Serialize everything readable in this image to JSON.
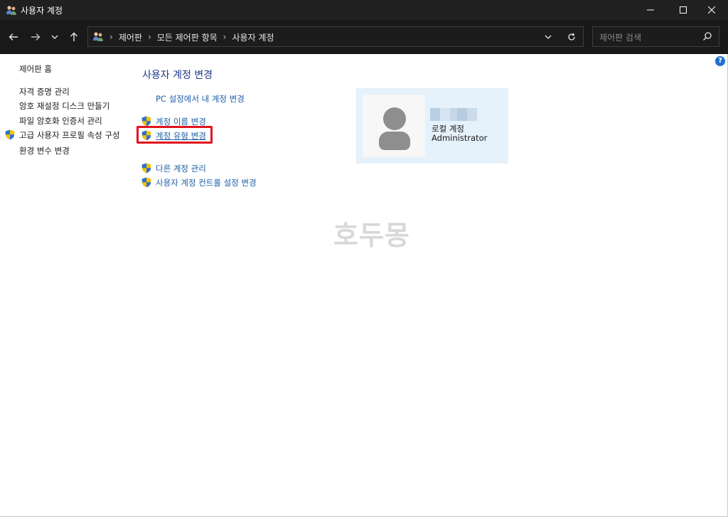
{
  "window": {
    "title": "사용자 계정"
  },
  "address": {
    "crumbs": [
      "제어판",
      "모든 제어판 항목",
      "사용자 계정"
    ],
    "separator": "›"
  },
  "search": {
    "placeholder": "제어판 검색"
  },
  "help": {
    "label": "?"
  },
  "sidebar": {
    "items": [
      {
        "label": "제어판 홈"
      },
      {
        "label": "자격 증명 관리"
      },
      {
        "label": "암호 재설정 디스크 만들기"
      },
      {
        "label": "파일 암호화 인증서 관리"
      },
      {
        "label": "고급 사용자 프로필 속성 구성",
        "shield": true
      },
      {
        "label": "환경 변수 변경"
      }
    ]
  },
  "main": {
    "title": "사용자 계정 변경",
    "tasks": [
      {
        "label": "PC 설정에서 내 계정 변경"
      },
      {
        "label": "계정 이름 변경",
        "shield": true
      },
      {
        "label": "계정 유형 변경",
        "shield": true,
        "highlighted": true
      },
      {
        "label": "다른 계정 관리",
        "shield": true
      },
      {
        "label": "사용자 계정 컨트롤 설정 변경",
        "shield": true
      }
    ]
  },
  "account": {
    "type": "로컬 계정",
    "group": "Administrator"
  },
  "watermark": "호두몽",
  "colors": {
    "titlebar": "#202020",
    "addressbar": "#191919",
    "link": "#1f5fa8",
    "title": "#1e3a8a",
    "highlight": "#e1141e",
    "card": "#e5f1fb"
  },
  "icons": {
    "back": "arrow-left-icon",
    "forward": "arrow-right-icon",
    "recent": "chevron-down-icon",
    "up": "arrow-up-icon",
    "refresh": "refresh-icon",
    "search": "search-icon",
    "shield": "uac-shield-icon",
    "users": "users-icon"
  }
}
